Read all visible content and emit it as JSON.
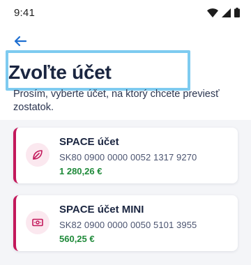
{
  "status_bar": {
    "time": "9:41",
    "icons": [
      "wifi-icon",
      "cellular-signal-icon",
      "battery-icon"
    ]
  },
  "header": {
    "back_icon": "arrow-left-icon",
    "title": "Zvoľte účet",
    "subtitle": "Prosím, vyberte účet, na ktorý chcete previesť zostatok."
  },
  "accounts": [
    {
      "icon": "leaf-icon",
      "name": "SPACE účet",
      "iban": "SK80 0900 0000 0052 1317 9270",
      "balance": "1 280,26 €"
    },
    {
      "icon": "banknote-icon",
      "name": "SPACE účet MINI",
      "iban": "SK82 0900 0000 0050 5101 3955",
      "balance": "560,25 €"
    }
  ],
  "colors": {
    "accent": "#c3185b",
    "back_arrow": "#1f6fd1",
    "balance": "#1f8a3a",
    "title": "#1a2540",
    "highlight_frame": "#7ecbf0"
  }
}
